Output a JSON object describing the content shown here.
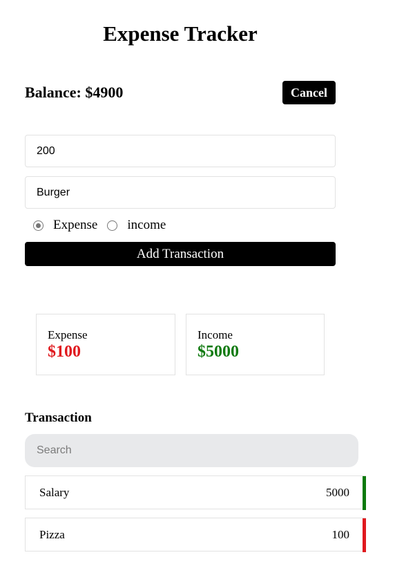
{
  "title": "Expense Tracker",
  "balance": {
    "text": "Balance: $4900"
  },
  "buttons": {
    "cancel": "Cancel",
    "add": "Add Transaction"
  },
  "form": {
    "amount_value": "200",
    "description_value": "Burger",
    "types": [
      {
        "label": "Expense",
        "selected": true
      },
      {
        "label": "income",
        "selected": false
      }
    ]
  },
  "summary": {
    "expense": {
      "label": "Expense",
      "value": "$100",
      "color": "#e0191e"
    },
    "income": {
      "label": "Income",
      "value": "$5000",
      "color": "#117a11"
    }
  },
  "transactions": {
    "heading": "Transaction",
    "search_placeholder": "Search",
    "items": [
      {
        "name": "Salary",
        "amount": "5000",
        "color": "#0b7a0b"
      },
      {
        "name": "Pizza",
        "amount": "100",
        "color": "#e0191e"
      }
    ]
  }
}
